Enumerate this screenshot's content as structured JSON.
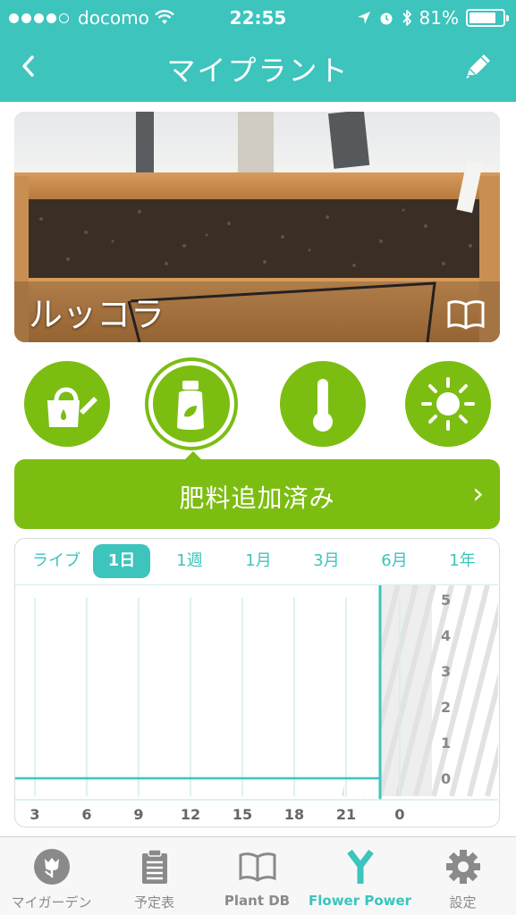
{
  "status_bar": {
    "carrier": "docomo",
    "time": "22:55",
    "battery": "81%",
    "signal_dots_filled": 4,
    "signal_dots_total": 5,
    "battery_level": 0.81
  },
  "nav": {
    "title": "マイプラント",
    "back_icon": "chevron-left-icon",
    "edit_icon": "pencil-icon"
  },
  "plant": {
    "name": "ルッコラ",
    "info_icon": "book-icon"
  },
  "categories": [
    {
      "name": "watering",
      "icon": "watering-can-icon",
      "selected": false
    },
    {
      "name": "fertilizer",
      "icon": "fertilizer-bottle-icon",
      "selected": true
    },
    {
      "name": "temperature",
      "icon": "thermometer-icon",
      "selected": false
    },
    {
      "name": "light",
      "icon": "sun-icon",
      "selected": false
    }
  ],
  "banner": {
    "text": "肥料追加済み",
    "chevron": "›"
  },
  "ranges": [
    {
      "label": "ライブ",
      "selected": false
    },
    {
      "label": "1日",
      "selected": true
    },
    {
      "label": "1週",
      "selected": false
    },
    {
      "label": "1月",
      "selected": false
    },
    {
      "label": "3月",
      "selected": false
    },
    {
      "label": "6月",
      "selected": false
    },
    {
      "label": "1年",
      "selected": false
    }
  ],
  "chart_data": {
    "type": "line",
    "title": "",
    "xlabel": "",
    "ylabel": "",
    "x_ticks": [
      "3",
      "6",
      "9",
      "12",
      "15",
      "18",
      "21",
      "0"
    ],
    "y_ticks": [
      "5",
      "4",
      "3",
      "2",
      "1",
      "0"
    ],
    "ylim": [
      0,
      5
    ],
    "series": [
      {
        "values": [
          0,
          0,
          0,
          0,
          0,
          0,
          0,
          0
        ]
      }
    ],
    "grid": true
  },
  "tabs": [
    {
      "label": "マイガーデン",
      "icon": "tulip-icon",
      "active": false
    },
    {
      "label": "予定表",
      "icon": "clipboard-icon",
      "active": false
    },
    {
      "label": "Plant DB",
      "icon": "book-icon",
      "active": false
    },
    {
      "label": "Flower Power",
      "icon": "flower-power-icon",
      "active": true
    },
    {
      "label": "設定",
      "icon": "gear-icon",
      "active": false
    }
  ],
  "colors": {
    "teal": "#3cc4bd",
    "green": "#7cbd12",
    "tab_inactive": "#8a8a8a"
  }
}
